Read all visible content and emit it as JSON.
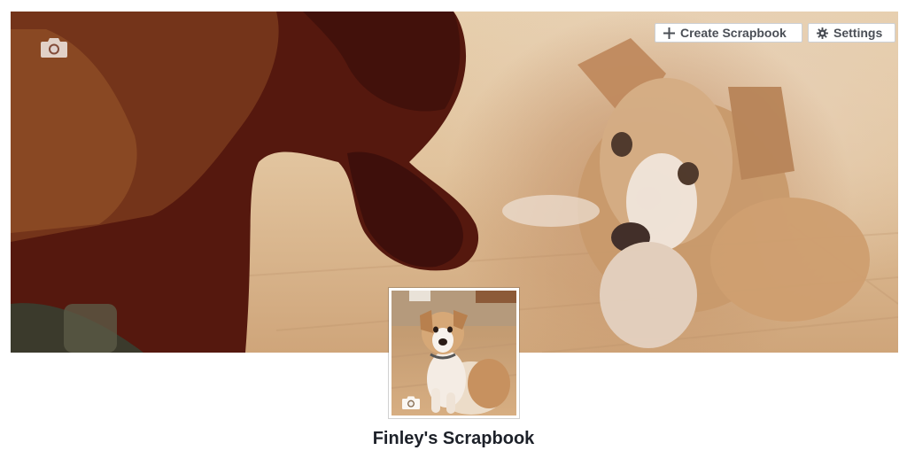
{
  "cover": {
    "camera_icon": "camera-icon"
  },
  "actions": {
    "create_label": "Create Scrapbook",
    "create_icon": "plus-icon",
    "settings_label": "Settings",
    "settings_icon": "gear-icon"
  },
  "profile": {
    "camera_icon": "camera-icon"
  },
  "page": {
    "title": "Finley's Scrapbook"
  }
}
